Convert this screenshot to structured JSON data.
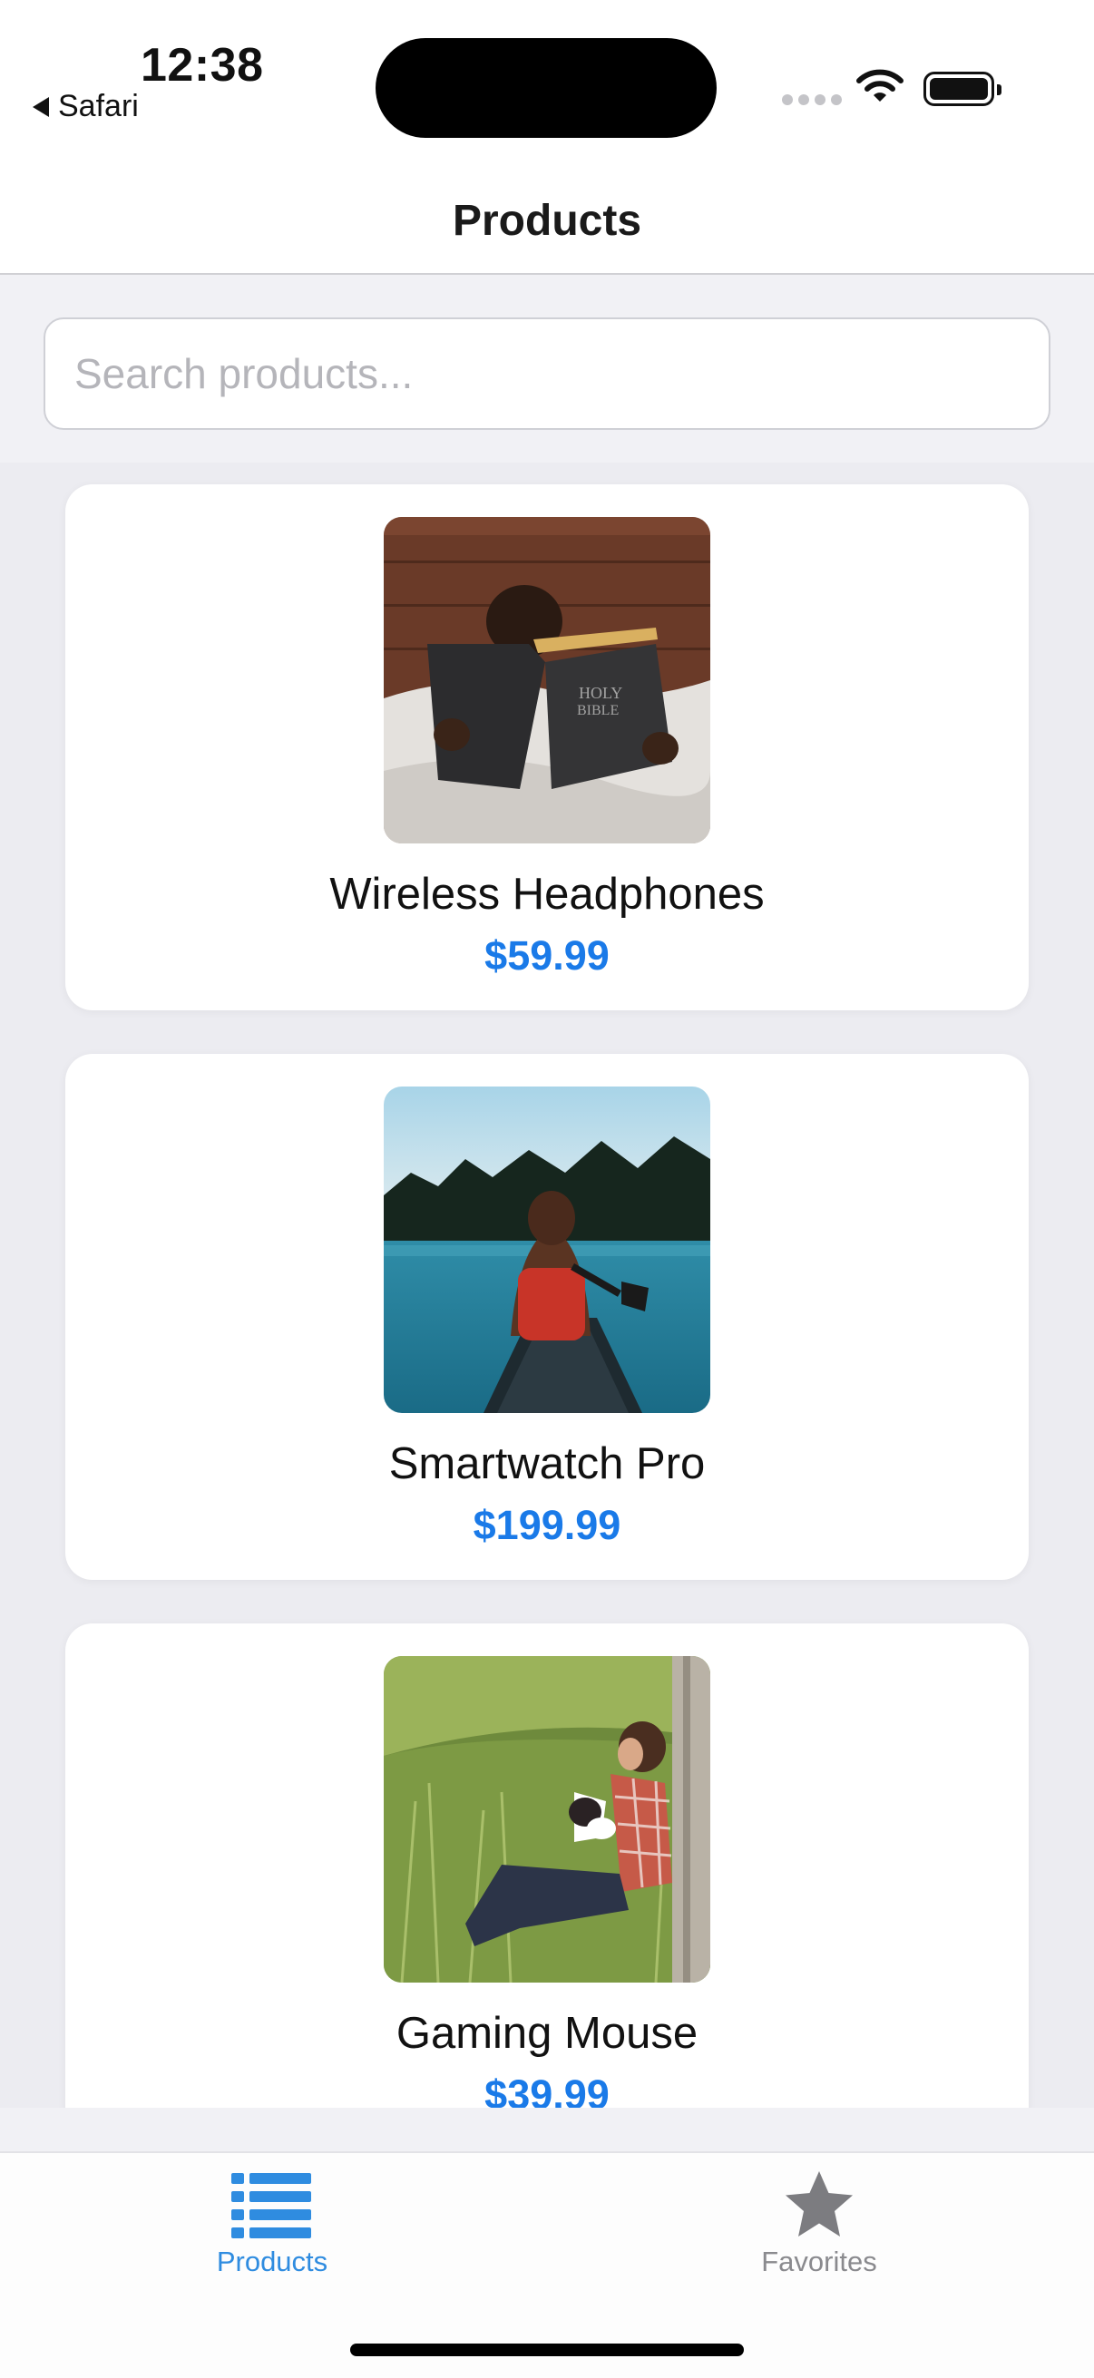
{
  "status_bar": {
    "time": "12:38",
    "back_app": "Safari"
  },
  "header": {
    "title": "Products"
  },
  "search": {
    "placeholder": "Search products...",
    "value": ""
  },
  "products": [
    {
      "name": "Wireless Headphones",
      "price": "$59.99",
      "image": "photo-child-reading-bible"
    },
    {
      "name": "Smartwatch Pro",
      "price": "$199.99",
      "image": "photo-woman-in-canoe-on-lake"
    },
    {
      "name": "Gaming Mouse",
      "price": "$39.99",
      "image": "photo-man-with-dog-in-grass"
    }
  ],
  "tab_bar": {
    "products_label": "Products",
    "favorites_label": "Favorites",
    "active": "Products"
  },
  "colors": {
    "accent": "#1a7ae8",
    "tab_active": "#2f8ce0",
    "tab_inactive": "#8a8a8e",
    "background": "#ececf1"
  }
}
